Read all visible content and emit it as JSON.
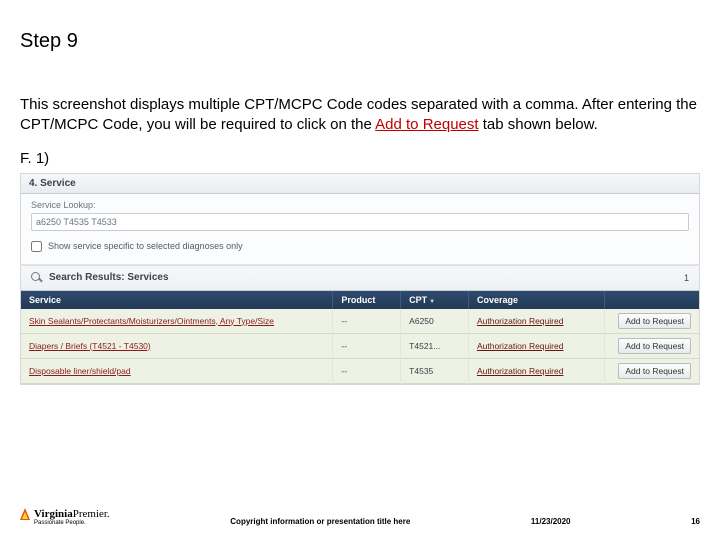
{
  "step_title": "Step 9",
  "description_before_link": "This screenshot displays multiple CPT/MCPC Code codes separated with a comma. After entering the CPT/MCPC Code, you will be required to click on the ",
  "description_link": "Add to Request",
  "description_after_link": " tab shown below.",
  "figure_label": "F. 1)",
  "app": {
    "section_title": "4. Service",
    "lookup_label": "Service Lookup:",
    "lookup_value": "a6250 T4535 T4533",
    "checkbox_label": "Show service specific to selected diagnoses only",
    "results_title": "Search Results: Services",
    "results_page": "1",
    "columns": {
      "service": "Service",
      "product": "Product",
      "cpt": "CPT",
      "coverage": "Coverage",
      "actions": ""
    },
    "rows": [
      {
        "service": "Skin Sealants/Protectants/Moisturizers/Ointments, Any Type/Size",
        "product": "--",
        "cpt": "A6250",
        "coverage": "Authorization Required",
        "action": "Add to Request"
      },
      {
        "service": "Diapers / Briefs (T4521 - T4530)",
        "product": "--",
        "cpt": "T4521...",
        "coverage": "Authorization Required",
        "action": "Add to Request"
      },
      {
        "service": "Disposable liner/shield/pad",
        "product": "--",
        "cpt": "T4535",
        "coverage": "Authorization Required",
        "action": "Add to Request"
      }
    ]
  },
  "footer": {
    "brand1": "Virginia",
    "brand2": "Premier.",
    "tagline": "Passionate People.",
    "copyright": "Copyright information or presentation title here",
    "date": "11/23/2020",
    "page": "16"
  }
}
